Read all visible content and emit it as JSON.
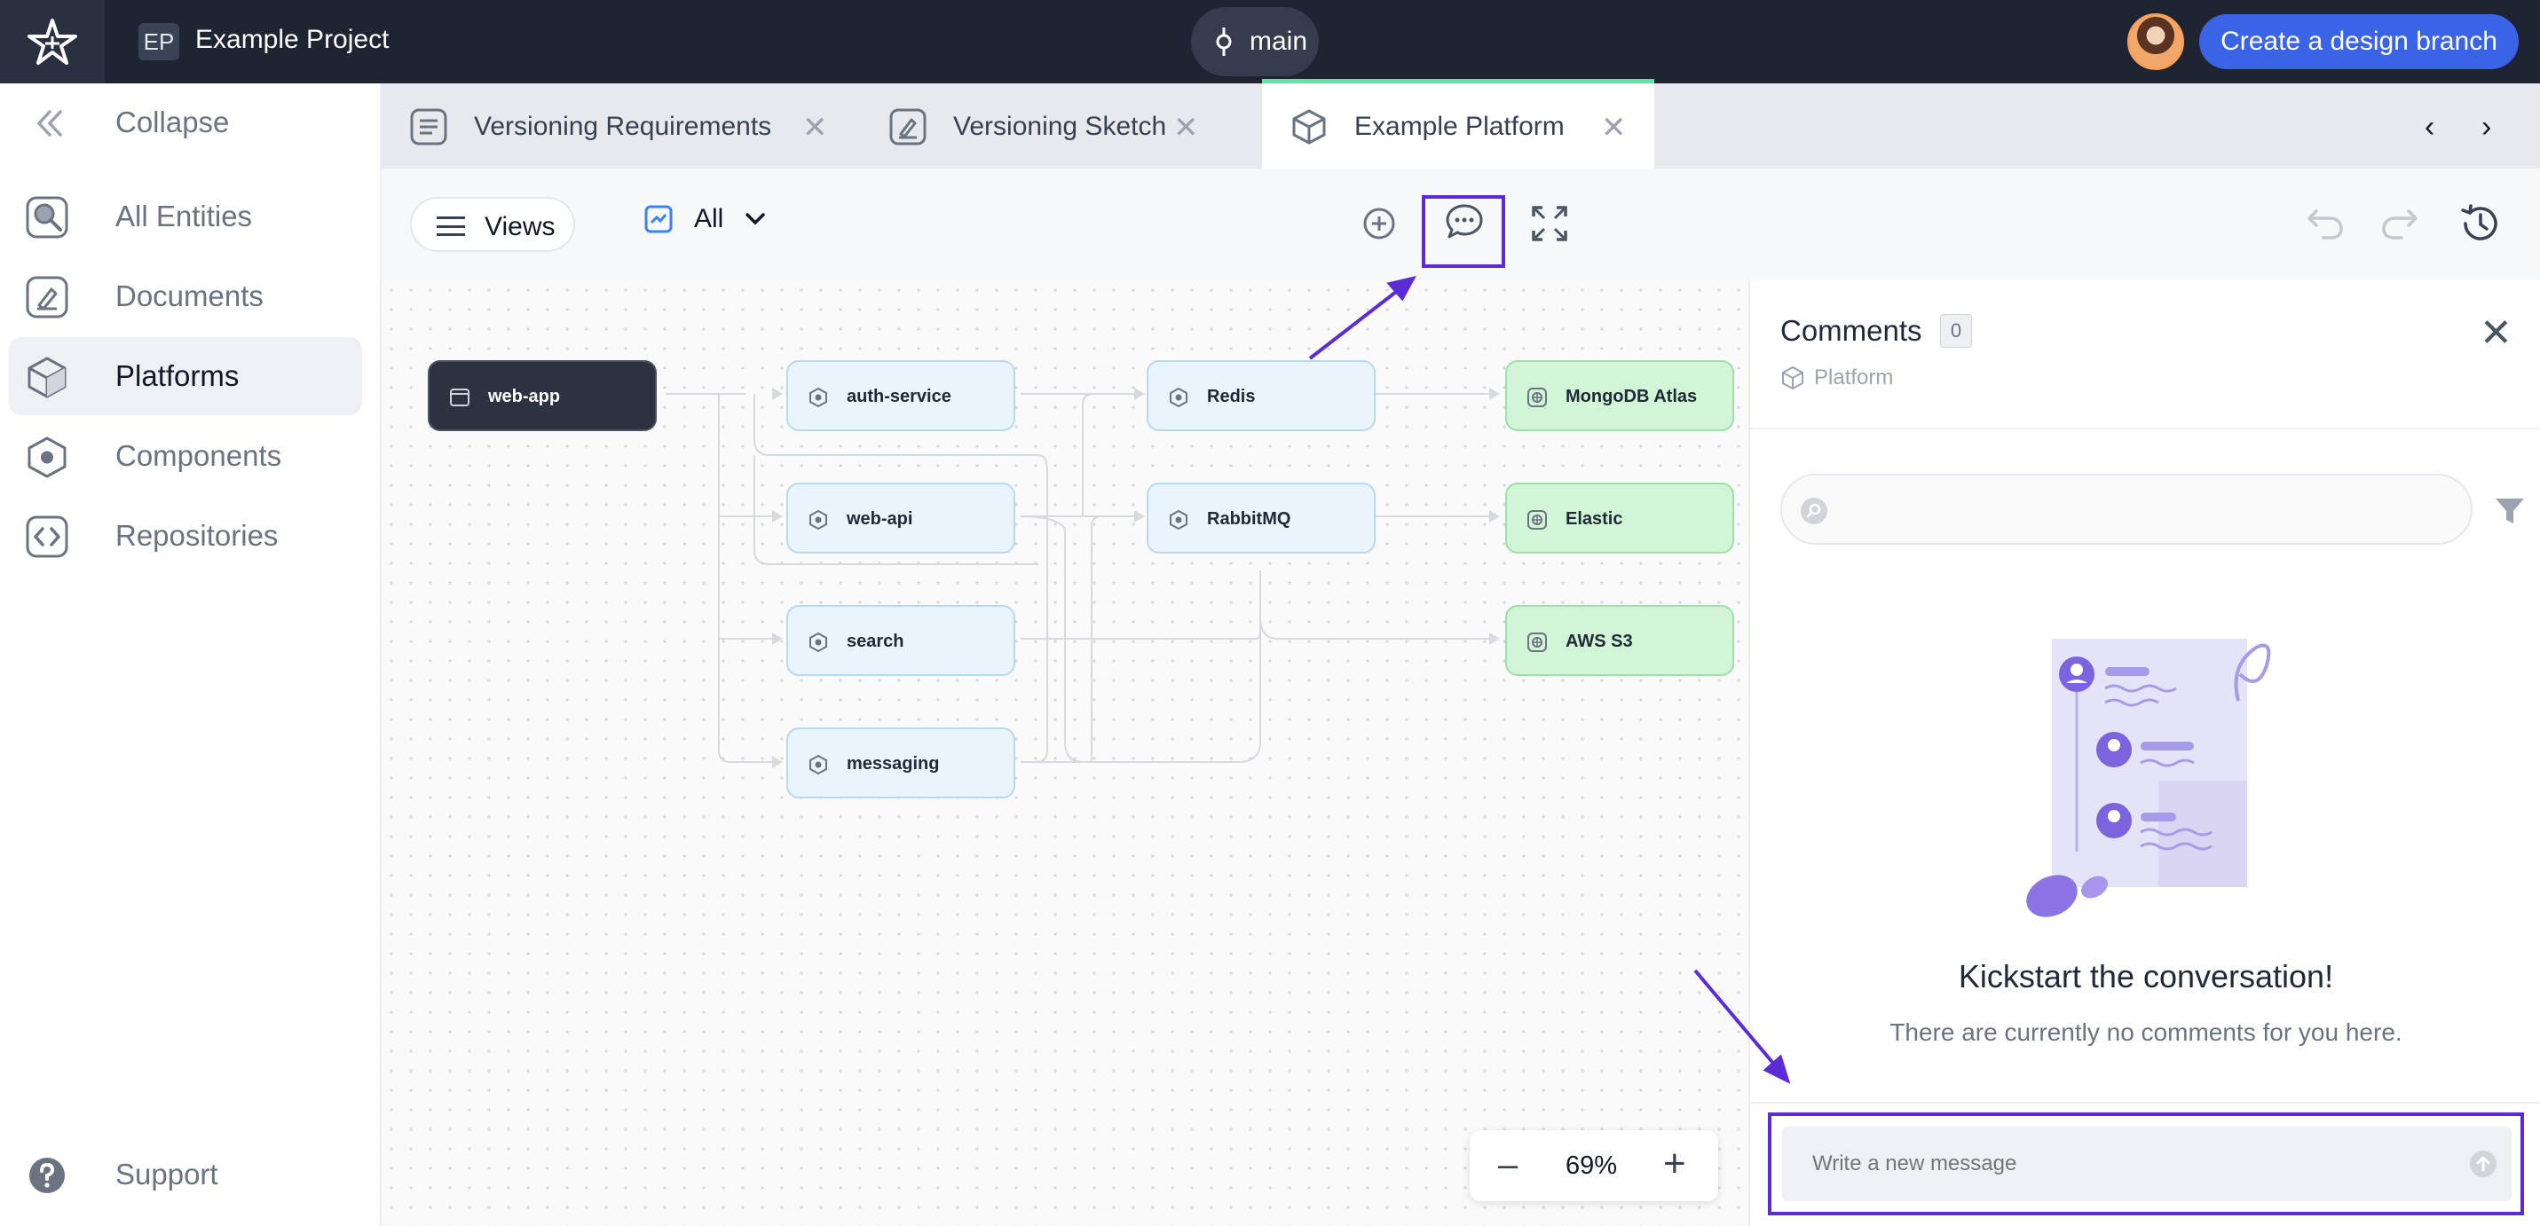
{
  "topbar": {
    "project_initials": "EP",
    "project_name": "Example Project",
    "branch": "main",
    "create_branch_label": "Create a design branch"
  },
  "sidebar": {
    "collapse_label": "Collapse",
    "items": [
      {
        "label": "All Entities",
        "icon": "search-entities-icon"
      },
      {
        "label": "Documents",
        "icon": "document-edit-icon"
      },
      {
        "label": "Platforms",
        "icon": "cube-icon",
        "active": true
      },
      {
        "label": "Components",
        "icon": "hexagon-icon"
      },
      {
        "label": "Repositories",
        "icon": "code-brackets-icon"
      }
    ],
    "support_label": "Support"
  },
  "tabs": [
    {
      "label": "Versioning Requirements",
      "icon": "document-icon"
    },
    {
      "label": "Versioning Sketch",
      "icon": "sketch-icon"
    },
    {
      "label": "Example Platform",
      "icon": "cube-icon",
      "active": true
    }
  ],
  "toolbar": {
    "views_label": "Views",
    "filter_label": "All"
  },
  "diagram": {
    "nodes": {
      "web_app": "web-app",
      "auth_service": "auth-service",
      "web_api": "web-api",
      "search": "search",
      "messaging": "messaging",
      "redis": "Redis",
      "rabbitmq": "RabbitMQ",
      "mongodb": "MongoDB Atlas",
      "elastic": "Elastic",
      "aws_s3": "AWS S3"
    },
    "zoom": "69%"
  },
  "comments": {
    "title": "Comments",
    "count": "0",
    "subtitle": "Platform",
    "search_placeholder": "",
    "empty_title": "Kickstart the conversation!",
    "empty_subtitle": "There are currently no comments for you here.",
    "composer_placeholder": "Write a new message"
  },
  "colors": {
    "accent": "#3b63e6",
    "highlight": "#5b2bd6",
    "node_dark": "#2c3240",
    "node_blue": "#e9f4fd",
    "node_green": "#d1f5d6"
  }
}
